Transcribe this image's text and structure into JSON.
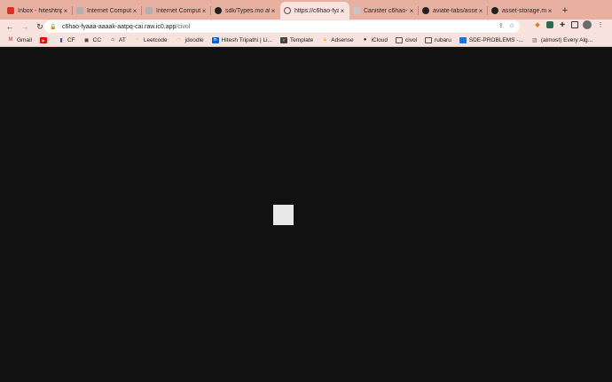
{
  "tabs": [
    {
      "title": "Inbox - hiteshtrip",
      "favicon_color": "#d93025"
    },
    {
      "title": "Internet Compute",
      "favicon_color": "#b0b0b0"
    },
    {
      "title": "Internet Compute",
      "favicon_color": "#b0b0b0"
    },
    {
      "title": "sdk/Types.mo at",
      "favicon_color": "#222222"
    },
    {
      "title": "https://c6hao-fya",
      "favicon_color": "#555555",
      "active": true
    },
    {
      "title": "Canister c6hao-fy",
      "favicon_color": "#c6c6c6"
    },
    {
      "title": "aviate-labs/asse",
      "favicon_color": "#222222"
    },
    {
      "title": "asset-storage.mo",
      "favicon_color": "#222222"
    }
  ],
  "new_tab_symbol": "+",
  "close_symbol": "×",
  "nav": {
    "back": "←",
    "forward": "→",
    "reload": "↻"
  },
  "address": {
    "host": "c6hao-fyaaa-aaaak-aatpq-cai.raw.ic0.app",
    "path": "/civol"
  },
  "bookmarks": [
    {
      "label": "Gmail",
      "icon": "gmail-icon",
      "color": "#d93025"
    },
    {
      "label": "",
      "icon": "youtube-icon",
      "color": "#ff0000"
    },
    {
      "label": "CF",
      "icon": "codeforces-icon",
      "color": "#1f5fbf"
    },
    {
      "label": "CC",
      "icon": "codechef-icon",
      "color": "#5b4638"
    },
    {
      "label": "AT",
      "icon": "atcoder-icon",
      "color": "#333333"
    },
    {
      "label": "Leetcode",
      "icon": "leetcode-icon",
      "color": "#f0a33a"
    },
    {
      "label": "jdoodle",
      "icon": "jdoodle-icon",
      "color": "#f4b000"
    },
    {
      "label": "Hitesh Tripathi | Li...",
      "icon": "linkedin-icon",
      "color": "#0a66c2"
    },
    {
      "label": "Template",
      "icon": "template-icon",
      "color": "#444444"
    },
    {
      "label": "Adsense",
      "icon": "adsense-icon",
      "color": "#fbbc04"
    },
    {
      "label": "iCloud",
      "icon": "apple-icon",
      "color": "#333333"
    },
    {
      "label": "civol",
      "icon": "folder-icon",
      "color": "#555555"
    },
    {
      "label": "rubaru",
      "icon": "folder-icon",
      "color": "#555555"
    },
    {
      "label": "SDE-PROBLEMS -...",
      "icon": "sheet-icon",
      "color": "#1a73e8"
    },
    {
      "label": "(almost) Every Alg...",
      "icon": "bar-chart-icon",
      "color": "#6b6b6b"
    }
  ],
  "page": {
    "background": "#111111",
    "square_color": "#e8e8e8"
  }
}
